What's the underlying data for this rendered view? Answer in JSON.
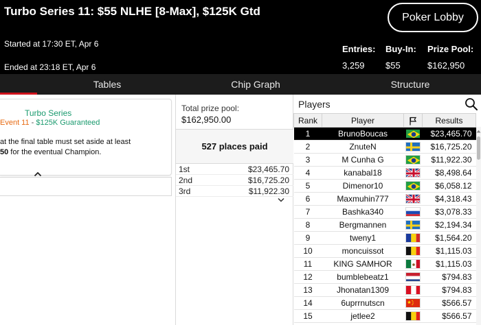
{
  "header": {
    "title": "Turbo Series 11: $55 NLHE [8-Max], $125K Gtd",
    "lobby_button": "Poker Lobby",
    "started": "Started at 17:30 ET, Apr 6",
    "ended": "Ended at 23:18 ET, Apr 6",
    "stats": [
      {
        "label": "Entries:",
        "value": "3,259"
      },
      {
        "label": "Buy-In:",
        "value": "$55"
      },
      {
        "label": "Prize Pool:",
        "value": "$162,950"
      }
    ]
  },
  "tabs": [
    {
      "label": "Tables"
    },
    {
      "label": "Chip Graph"
    },
    {
      "label": "Structure"
    }
  ],
  "promo": {
    "series_name": "Turbo Series",
    "event": "Event 11",
    "separator": " - ",
    "guarantee": "$125K Guaranteed",
    "text_line1": "at the final table must set aside at least",
    "text_bold": "50",
    "text_line2": " for the eventual Champion."
  },
  "prize": {
    "pool_label": "Total prize pool:",
    "pool_value": "$162,950.00",
    "places_paid": "527 places paid",
    "payouts": [
      {
        "place": "1st",
        "amount": "$23,465.70"
      },
      {
        "place": "2nd",
        "amount": "$16,725.20"
      },
      {
        "place": "3rd",
        "amount": "$11,922.30"
      }
    ]
  },
  "players": {
    "title": "Players",
    "columns": {
      "rank": "Rank",
      "player": "Player",
      "results": "Results"
    },
    "rows": [
      {
        "rank": "1",
        "name": "BrunoBoucas",
        "flag": "brazil",
        "result": "$23,465.70"
      },
      {
        "rank": "2",
        "name": "ZnuteN",
        "flag": "sweden",
        "result": "$16,725.20"
      },
      {
        "rank": "3",
        "name": "M Cunha G",
        "flag": "brazil",
        "result": "$11,922.30"
      },
      {
        "rank": "4",
        "name": "kanabal18",
        "flag": "uk",
        "result": "$8,498.64"
      },
      {
        "rank": "5",
        "name": "Dimenor10",
        "flag": "brazil",
        "result": "$6,058.12"
      },
      {
        "rank": "6",
        "name": "Maxmuhin777",
        "flag": "uk",
        "result": "$4,318.43"
      },
      {
        "rank": "7",
        "name": "Bashka340",
        "flag": "russia",
        "result": "$3,078.33"
      },
      {
        "rank": "8",
        "name": "Bergmannen",
        "flag": "sweden",
        "result": "$2,194.34"
      },
      {
        "rank": "9",
        "name": "tweny1",
        "flag": "romania",
        "result": "$1,564.20"
      },
      {
        "rank": "10",
        "name": "moncuissot",
        "flag": "belgium",
        "result": "$1,115.03"
      },
      {
        "rank": "11",
        "name": "KING SAMHOR",
        "flag": "mexico",
        "result": "$1,115.03"
      },
      {
        "rank": "12",
        "name": "bumblebeatz1",
        "flag": "netherlands",
        "result": "$794.83"
      },
      {
        "rank": "13",
        "name": "Jhonatan1309",
        "flag": "peru",
        "result": "$794.83"
      },
      {
        "rank": "14",
        "name": "6uprrnutscn",
        "flag": "china",
        "result": "$566.57"
      },
      {
        "rank": "15",
        "name": "jetlee2",
        "flag": "belgium",
        "result": "$566.57"
      }
    ]
  },
  "colors": {
    "header_bg": "#000000",
    "tab_bar_bg": "#1c1c1c",
    "tab_indicator": "#d0121b",
    "promo_green": "#1a9a6e",
    "promo_orange": "#e76a12",
    "selected_row_bg": "#000000"
  },
  "icons": {
    "search": "search-icon",
    "flag_header": "flag-icon",
    "collapse": "chevron-up-icon",
    "expand": "chevron-down-icon"
  }
}
